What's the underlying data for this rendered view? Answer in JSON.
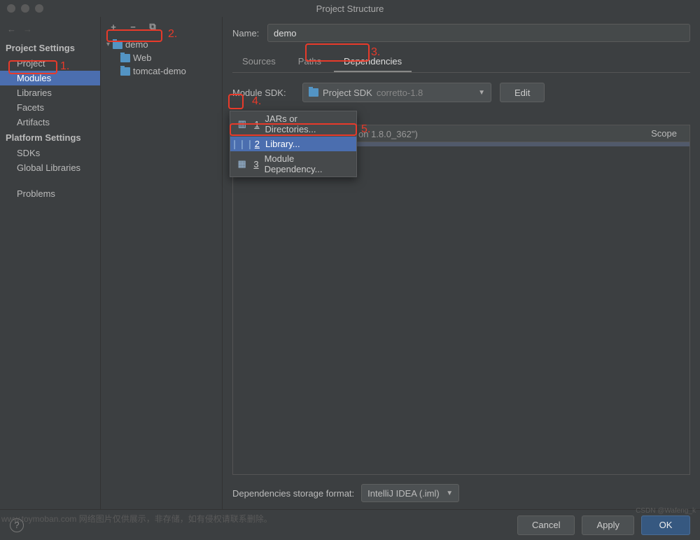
{
  "window": {
    "title": "Project Structure"
  },
  "sidebar": {
    "headings": {
      "project": "Project Settings",
      "platform": "Platform Settings"
    },
    "project_items": [
      {
        "label": "Project"
      },
      {
        "label": "Modules",
        "selected": true
      },
      {
        "label": "Libraries"
      },
      {
        "label": "Facets"
      },
      {
        "label": "Artifacts"
      }
    ],
    "platform_items": [
      {
        "label": "SDKs"
      },
      {
        "label": "Global Libraries"
      }
    ],
    "problems": "Problems"
  },
  "tree": {
    "root": "demo",
    "children": [
      {
        "label": "Web"
      },
      {
        "label": "tomcat-demo"
      }
    ]
  },
  "form": {
    "name_label": "Name:",
    "name_value": "demo",
    "tabs": [
      {
        "label": "Sources"
      },
      {
        "label": "Paths"
      },
      {
        "label": "Dependencies",
        "active": true
      }
    ],
    "sdk_label": "Module SDK:",
    "sdk_value_prefix": "Project SDK",
    "sdk_value_suffix": "corretto-1.8",
    "edit_btn": "Edit",
    "scope_header": "Scope",
    "dep_row_fragment": "on 1.8.0_362\")",
    "storage_label": "Dependencies storage format:",
    "storage_value": "IntelliJ IDEA (.iml)"
  },
  "popup": {
    "items": [
      {
        "idx": "1",
        "label": "JARs or Directories..."
      },
      {
        "idx": "2",
        "label": "Library...",
        "sel": true
      },
      {
        "idx": "3",
        "label": "Module Dependency..."
      }
    ]
  },
  "footer": {
    "cancel": "Cancel",
    "apply": "Apply",
    "ok": "OK"
  },
  "annotations": {
    "a1": "1.",
    "a2": "2.",
    "a3": "3.",
    "a4": "4.",
    "a5": "5."
  },
  "watermark": "www.toymoban.com 网络图片仅供展示，非存储，如有侵权请联系删除。",
  "watermark2": "CSDN @Wafeng_k"
}
